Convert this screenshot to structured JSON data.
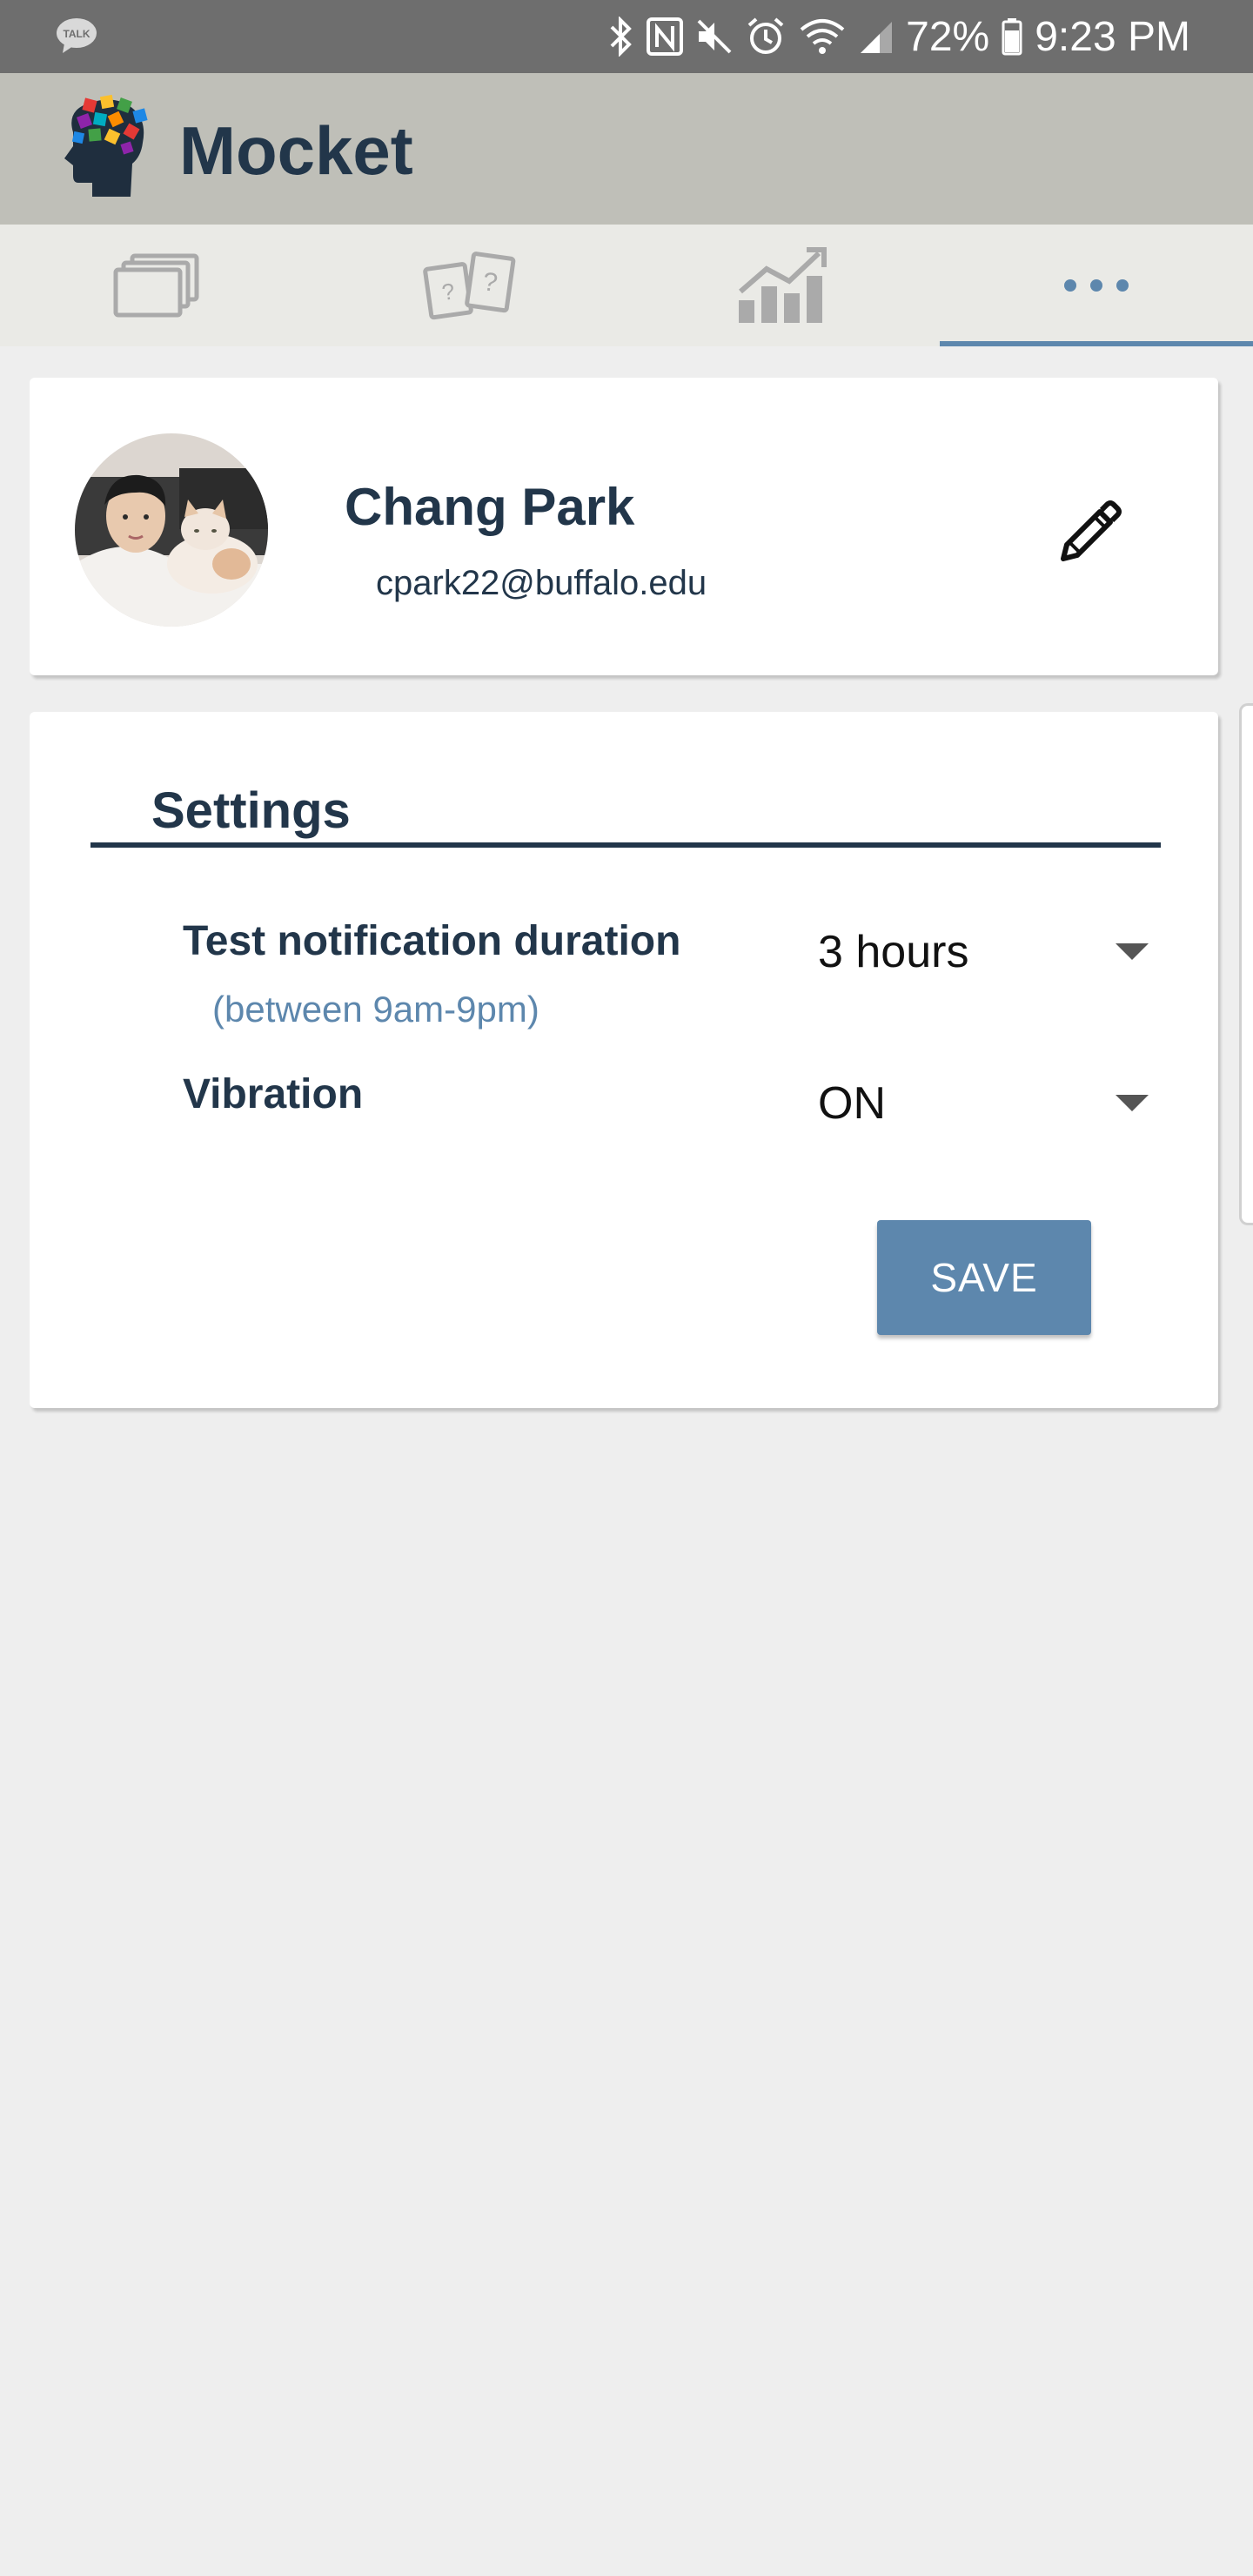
{
  "status_bar": {
    "battery": "72%",
    "time": "9:23 PM",
    "icons": [
      "talk-icon",
      "bluetooth-icon",
      "nfc-icon",
      "mute-icon",
      "alarm-icon",
      "wifi-icon",
      "signal-icon",
      "battery-icon"
    ]
  },
  "app": {
    "title": "Mocket"
  },
  "tabs": [
    {
      "name": "cards",
      "icon": "cards-icon",
      "active": false
    },
    {
      "name": "quiz",
      "icon": "question-cards-icon",
      "active": false
    },
    {
      "name": "stats",
      "icon": "chart-icon",
      "active": false
    },
    {
      "name": "more",
      "icon": "more-icon",
      "active": true
    }
  ],
  "profile": {
    "name": "Chang Park",
    "email": "cpark22@buffalo.edu"
  },
  "settings": {
    "title": "Settings",
    "notification": {
      "label": "Test notification duration",
      "hint": "(between 9am-9pm)",
      "value": "3 hours"
    },
    "vibration": {
      "label": "Vibration",
      "value": "ON"
    },
    "save_label": "SAVE"
  },
  "colors": {
    "accent": "#5d87ad",
    "text_dark": "#22364a",
    "header_bg": "#bfbfb8",
    "status_bg": "#6e6e6e",
    "page_bg": "#eeeeee"
  }
}
